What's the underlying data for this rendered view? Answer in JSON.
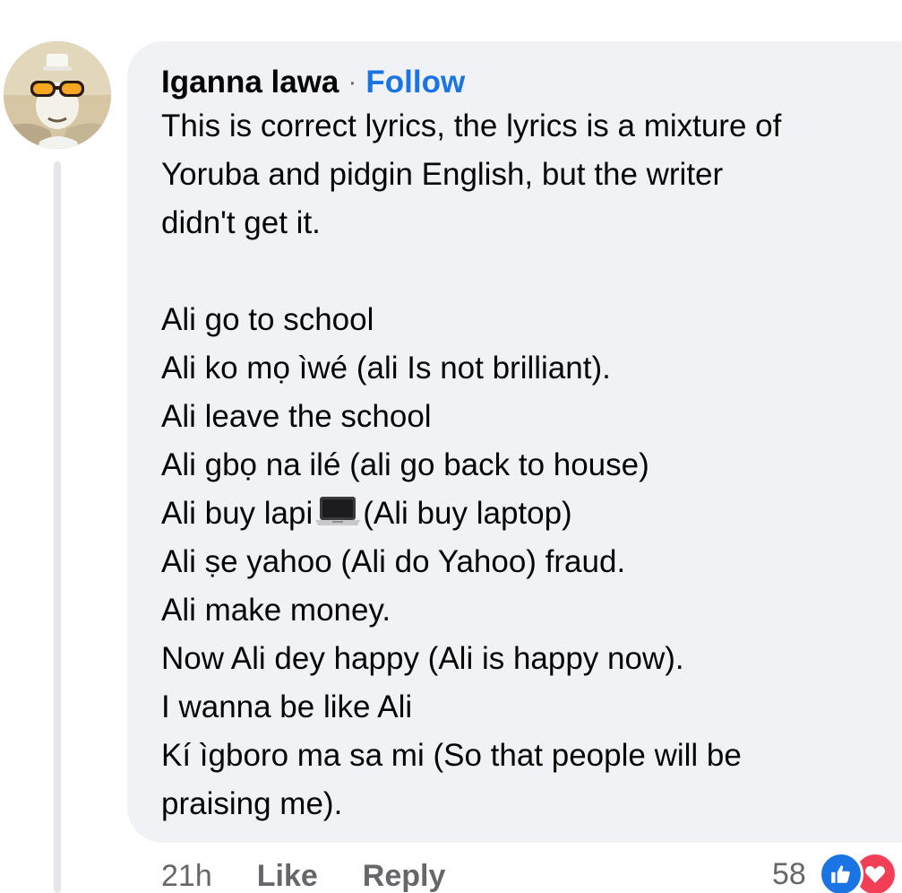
{
  "comment": {
    "author": "Iganna lawa",
    "separator": "·",
    "follow_label": "Follow",
    "lines": [
      "This is correct lyrics, the lyrics is a mixture of",
      "Yoruba and pidgin English, but the writer",
      "didn't get it.",
      "",
      "Ali go to school",
      "Ali ko mọ ìwé (ali Is not brilliant).",
      "Ali leave the school",
      "Ali gbọ na ilé (ali go back to house)",
      "Ali buy lapi",
      "Ali ṣe yahoo (Ali do Yahoo) fraud.",
      "Ali make money.",
      "Now Ali dey happy (Ali is happy now).",
      "I wanna be like Ali",
      "Kí ìgboro ma sa mi (So that people will be",
      "praising me)."
    ],
    "laptop_line_suffix": "(Ali buy laptop)",
    "laptop_emoji": "laptop-icon"
  },
  "actions": {
    "time": "21h",
    "like_label": "Like",
    "reply_label": "Reply"
  },
  "reactions": {
    "count": "58",
    "icons": [
      "like-icon",
      "heart-icon"
    ],
    "colors": {
      "like": "#1b74e4",
      "heart": "#f33e58"
    }
  },
  "colors": {
    "bubble": "#f0f2f5",
    "link": "#1b74e4",
    "text": "#050505",
    "muted": "#65676b"
  }
}
